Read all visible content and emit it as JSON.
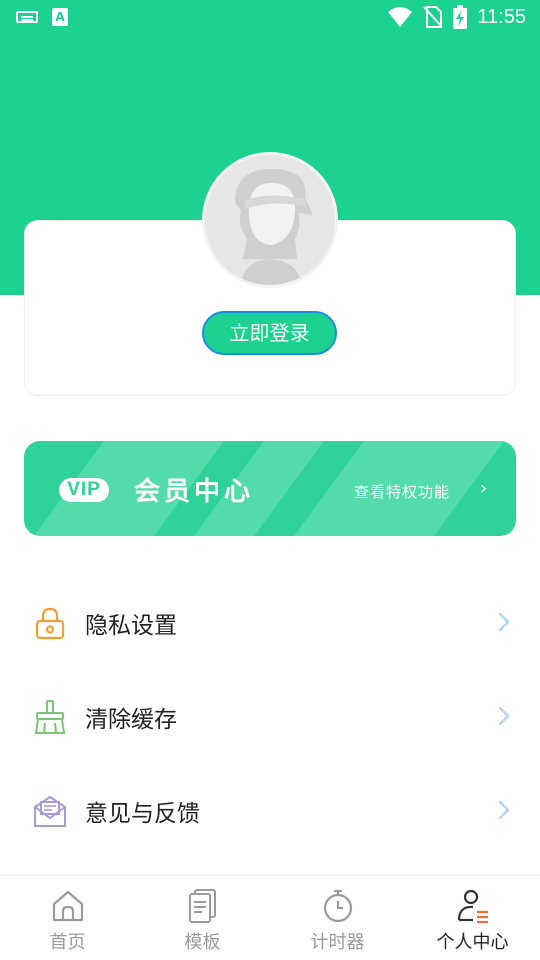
{
  "status_bar": {
    "time": "11:55",
    "a_icon_text": "A"
  },
  "profile": {
    "login_button": "立即登录"
  },
  "vip": {
    "badge": "VIP",
    "title": "会员中心",
    "subtitle": "查看特权功能",
    "arrow": "›"
  },
  "menu": {
    "items": [
      {
        "label": "隐私设置",
        "icon": "lock-icon"
      },
      {
        "label": "清除缓存",
        "icon": "broom-icon"
      },
      {
        "label": "意见与反馈",
        "icon": "mail-icon"
      }
    ]
  },
  "bottom_nav": {
    "items": [
      {
        "label": "首页",
        "icon": "home-icon"
      },
      {
        "label": "模板",
        "icon": "template-icon"
      },
      {
        "label": "计时器",
        "icon": "timer-icon"
      },
      {
        "label": "个人中心",
        "icon": "profile-icon",
        "active": true
      }
    ]
  },
  "colors": {
    "brand_green": "#1dd191",
    "vip_green": "#2fd39a",
    "lock_orange": "#f0a030",
    "broom_green": "#7cc576",
    "mail_purple": "#a89ad8",
    "chevron_blue": "#b9d4f0"
  }
}
